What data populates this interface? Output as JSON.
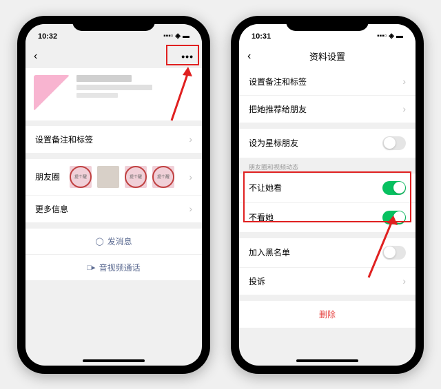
{
  "left": {
    "status_time": "10:32",
    "profile": {
      "set_remark_label": "设置备注和标签",
      "moments_label": "朋友圈",
      "more_info_label": "更多信息"
    },
    "actions": {
      "send_message": "发消息",
      "video_call": "音视频通话"
    }
  },
  "right": {
    "status_time": "10:31",
    "title": "资料设置",
    "items": {
      "set_remark": "设置备注和标签",
      "recommend": "把她推荐给朋友",
      "star_friend": "设为星标朋友",
      "hint_moments": "朋友圈和视频动态",
      "block_her_view": "不让她看",
      "dont_see_her": "不看她",
      "blacklist": "加入黑名单",
      "complain": "投诉",
      "delete": "删除"
    },
    "toggles": {
      "star_friend": false,
      "block_her_view": true,
      "dont_see_her": true,
      "blacklist": false
    }
  }
}
